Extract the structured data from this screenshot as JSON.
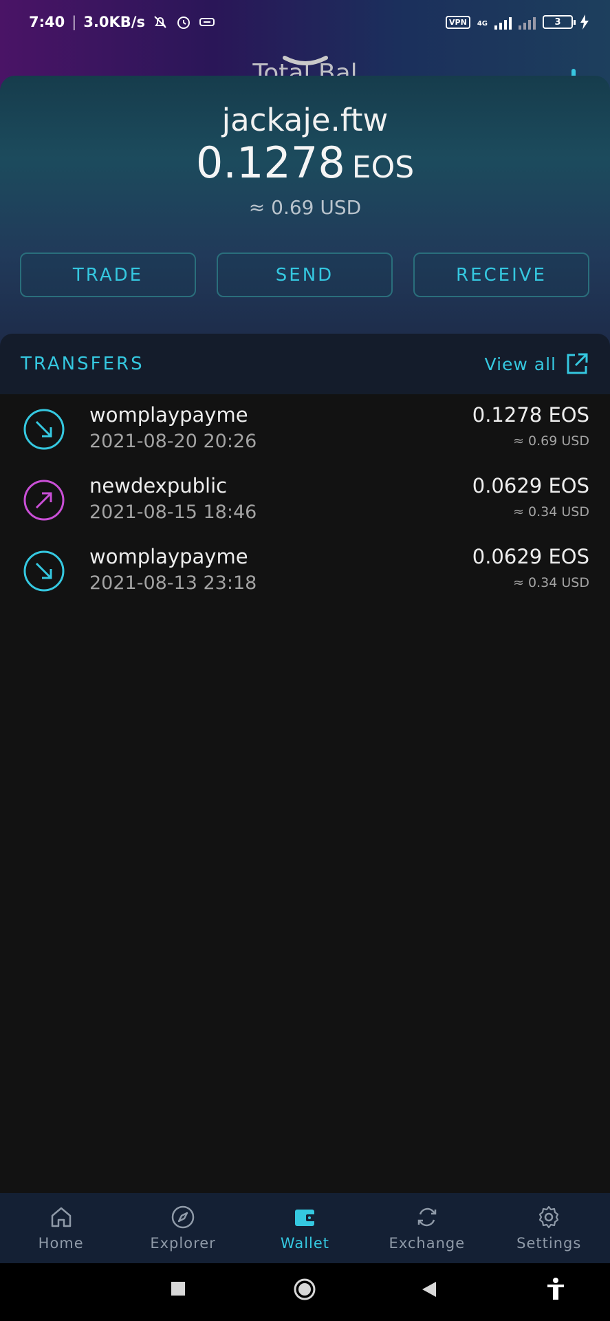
{
  "status_bar": {
    "time": "7:40",
    "speed": "3.0KB/s",
    "vpn": "VPN",
    "network": "4G",
    "battery": "3"
  },
  "peek_title": "Total Bal",
  "wallet": {
    "account": "jackaje.ftw",
    "balance": "0.1278",
    "unit": "EOS",
    "fiat": "≈ 0.69 USD"
  },
  "actions": {
    "trade": "TRADE",
    "send": "SEND",
    "receive": "RECEIVE"
  },
  "transfers": {
    "title": "TRANSFERS",
    "view_all": "View all",
    "items": [
      {
        "name": "womplaypayme",
        "date": "2021-08-20 20:26",
        "amount": "0.1278 EOS",
        "fiat": "≈ 0.69 USD",
        "direction": "incoming",
        "color": "#35c8e0"
      },
      {
        "name": "newdexpublic",
        "date": "2021-08-15 18:46",
        "amount": "0.0629 EOS",
        "fiat": "≈ 0.34 USD",
        "direction": "outgoing",
        "color": "#c94fd6"
      },
      {
        "name": "womplaypayme",
        "date": "2021-08-13 23:18",
        "amount": "0.0629 EOS",
        "fiat": "≈ 0.34 USD",
        "direction": "incoming",
        "color": "#35c8e0"
      }
    ]
  },
  "nav": {
    "home": "Home",
    "explorer": "Explorer",
    "wallet": "Wallet",
    "exchange": "Exchange",
    "settings": "Settings",
    "active": "wallet"
  },
  "colors": {
    "accent": "#35c8e0",
    "outgoing": "#c94fd6"
  }
}
